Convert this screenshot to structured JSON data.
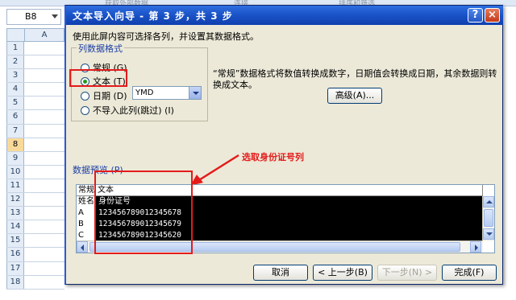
{
  "excel": {
    "ribbon_ghost_left": "获取外部数据",
    "ribbon_ghost_mid": "连接",
    "ribbon_ghost_right": "排序和筛选",
    "name_box": "B8",
    "column": "A",
    "row_numbers": [
      "1",
      "2",
      "3",
      "4",
      "5",
      "6",
      "7",
      "8",
      "9",
      "10",
      "11",
      "12",
      "13",
      "14",
      "15",
      "16",
      "17",
      "18"
    ],
    "selected_row": "8"
  },
  "dialog": {
    "title": "文本导入向导 - 第 3 步，共 3 步",
    "help_label": "?",
    "close_label": "×",
    "instruction": "使用此屏内容可选择各列，并设置其数据格式。",
    "column_format_legend": "列数据格式",
    "radios": [
      {
        "label": "常规",
        "key": "G",
        "selected": false
      },
      {
        "label": "文本",
        "key": "T",
        "selected": true
      },
      {
        "label": "日期",
        "key": "D",
        "selected": false
      },
      {
        "label": "不导入此列(跳过)",
        "key": "I",
        "selected": false
      }
    ],
    "radio_labels": [
      "常规 (G)",
      "文本 (T)",
      "日期 (D)",
      "不导入此列(跳过) (I)"
    ],
    "date_format": "YMD",
    "description": "“常规”数据格式将数值转换成数字，日期值会转换成日期，其余数据则转换成文本。",
    "advanced_button": "高级(A)...",
    "annotation": "选取身份证号列",
    "preview_label": "数据预览 (P)",
    "preview_headers": [
      "常规",
      "文本"
    ],
    "preview_rows": [
      {
        "c1": "姓名",
        "c2": "身份证号"
      },
      {
        "c1": "A",
        "c2": "123456789012345678"
      },
      {
        "c1": "B",
        "c2": "123456789012345679"
      },
      {
        "c1": "C",
        "c2": "123456789012345620"
      }
    ],
    "buttons": {
      "cancel": "取消",
      "back": "< 上一步(B)",
      "next": "下一步(N) >",
      "finish": "完成(F)"
    }
  },
  "colors": {
    "title_bar": "#1b55c9",
    "dialog_bg": "#ece9d8",
    "annotation_red": "#e31b1b",
    "selected_column_bg": "#000000"
  }
}
